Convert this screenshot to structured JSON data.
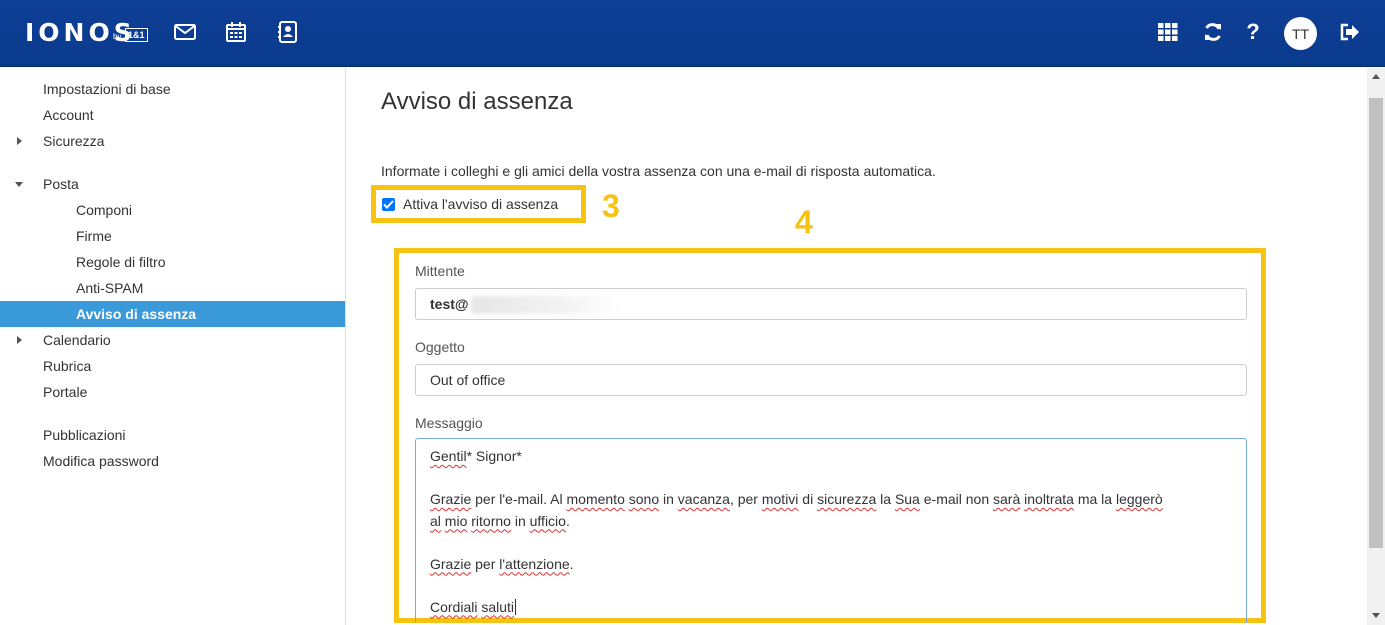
{
  "header": {
    "logo": "IONOS",
    "logo_by": "by",
    "logo_brand": "1&1",
    "avatar_initials": "TT"
  },
  "sidebar": {
    "items": [
      {
        "label": "Impostazioni di base"
      },
      {
        "label": "Account"
      },
      {
        "label": "Sicurezza"
      },
      {
        "label": "Posta"
      },
      {
        "label": "Componi"
      },
      {
        "label": "Firme"
      },
      {
        "label": "Regole di filtro"
      },
      {
        "label": "Anti-SPAM"
      },
      {
        "label": "Avviso di assenza"
      },
      {
        "label": "Calendario"
      },
      {
        "label": "Rubrica"
      },
      {
        "label": "Portale"
      },
      {
        "label": "Pubblicazioni"
      },
      {
        "label": "Modifica password"
      }
    ]
  },
  "main": {
    "title": "Avviso di assenza",
    "intro": "Informate i colleghi e gli amici della vostra assenza con una e-mail di risposta automatica.",
    "checkbox_label": "Attiva l'avviso di assenza",
    "checkbox_checked": true,
    "annotation_3": "3",
    "annotation_4": "4",
    "sender_label": "Mittente",
    "sender_value": "test@",
    "subject_label": "Oggetto",
    "subject_value": "Out of office",
    "message_label": "Messaggio",
    "message": {
      "line1_a": "Gentil",
      "line1_b": "* Signor*",
      "p2_w1": "Grazie",
      "p2_t1": " per l'e-mail. Al ",
      "p2_w2": "momento",
      "p2_t2": " ",
      "p2_w3": "sono",
      "p2_t3": " in ",
      "p2_w4": "vacanza",
      "p2_t4": ", per ",
      "p2_w5": "motivi",
      "p2_t5": " di ",
      "p2_w6": "sicurezza",
      "p2_t6": " la ",
      "p2_w7": "Sua",
      "p2_t7": " e-mail non ",
      "p2_w8": "sarà",
      "p2_t8": " ",
      "p2_w9": "inoltrata",
      "p2_t9": " ma la ",
      "p2_w10": "leggerò",
      "p2_w11": "al",
      "p2_t11": " ",
      "p2_w12": "mio",
      "p2_t12": " ",
      "p2_w13": "ritorno",
      "p2_t13": " in ",
      "p2_w14": "ufficio",
      "p2_t14": ".",
      "p3_w1": "Grazie",
      "p3_t1": " per ",
      "p3_w2": "l'attenzione",
      "p3_t2": ".",
      "p4_w1": "Cordiali",
      "p4_t1": " ",
      "p4_w2": "saluti"
    }
  },
  "colors": {
    "header_bg": "#0b3d91",
    "active_item_bg": "#3a9ad9",
    "highlight": "#f6c313"
  }
}
